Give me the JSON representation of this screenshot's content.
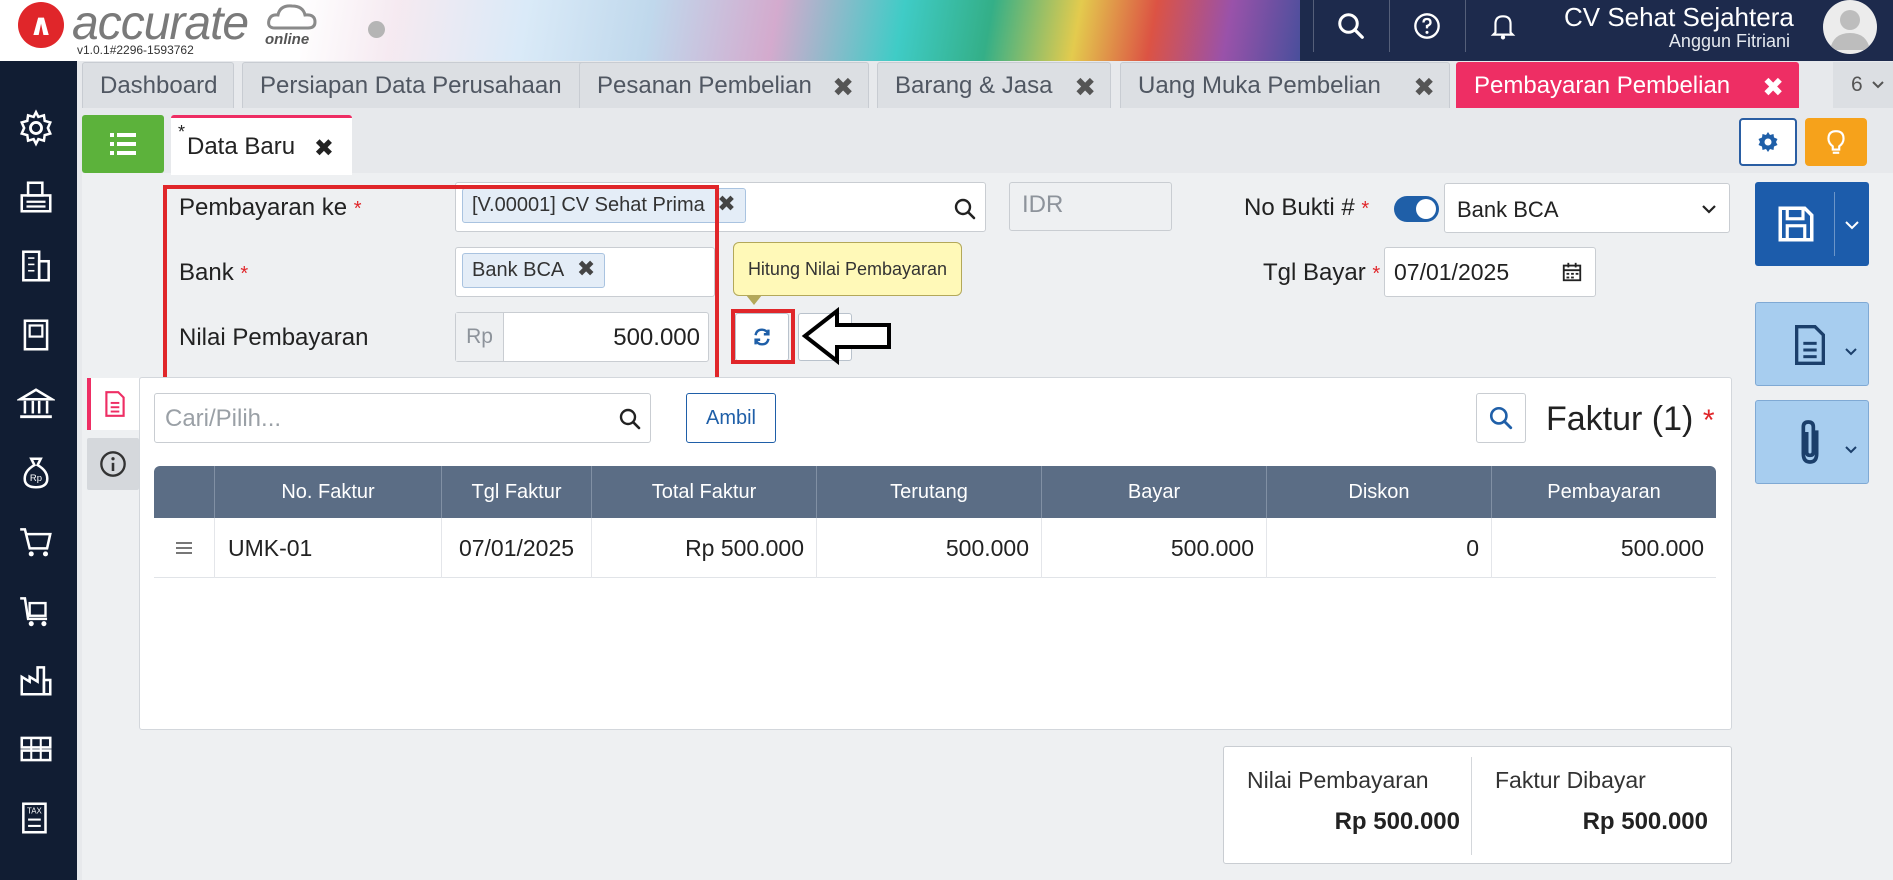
{
  "header": {
    "brand": "accurate",
    "brand_sub": "online",
    "version": "v1.0.1#2296-1593762",
    "company": "CV Sehat Sejahtera",
    "user": "Anggun Fitriani",
    "icons": [
      "search-icon",
      "help-icon",
      "bell-icon",
      "avatar"
    ]
  },
  "sidebar": {
    "items": [
      "gear-icon",
      "fax-icon",
      "building-icon",
      "book-icon",
      "bank-icon",
      "money-bag-icon",
      "cart-icon",
      "cart-box-icon",
      "factory-icon",
      "warehouse-icon",
      "tax-icon"
    ]
  },
  "module_tabs": [
    {
      "label": "Dashboard",
      "closable": false,
      "active": false
    },
    {
      "label": "Persiapan Data Perusahaan",
      "closable": false,
      "active": false
    },
    {
      "label": "Pesanan Pembelian",
      "closable": true,
      "active": false
    },
    {
      "label": "Barang & Jasa",
      "closable": true,
      "active": false
    },
    {
      "label": "Uang Muka Pembelian",
      "closable": true,
      "active": false
    },
    {
      "label": "Pembayaran Pembelian",
      "closable": true,
      "active": true
    }
  ],
  "tab_count": "6",
  "close_symbol": "✖",
  "subtab": {
    "star": "*",
    "label": "Data Baru"
  },
  "form": {
    "pembayaran_ke_label": "Pembayaran ke",
    "pembayaran_ke_value": "[V.00001] CV Sehat Prima",
    "currency": "IDR",
    "bank_label": "Bank",
    "bank_value": "Bank BCA",
    "nilai_label": "Nilai Pembayaran",
    "nilai_prefix": "Rp",
    "nilai_value": "500.000",
    "tooltip": "Hitung Nilai Pembayaran",
    "no_bukti_label": "No Bukti #",
    "no_bukti_value": "Bank BCA",
    "tgl_bayar_label": "Tgl Bayar",
    "tgl_bayar_value": "07/01/2025",
    "required_mark": "*"
  },
  "detail": {
    "search_placeholder": "Cari/Pilih...",
    "ambil_label": "Ambil",
    "title": "Faktur (1)",
    "columns": [
      "No. Faktur",
      "Tgl Faktur",
      "Total Faktur",
      "Terutang",
      "Bayar",
      "Diskon",
      "Pembayaran"
    ],
    "rows": [
      {
        "no_faktur": "UMK-01",
        "tgl_faktur": "07/01/2025",
        "total_faktur": "Rp 500.000",
        "terutang": "500.000",
        "bayar": "500.000",
        "diskon": "0",
        "pembayaran": "500.000"
      }
    ]
  },
  "totals": {
    "nilai_label": "Nilai Pembayaran",
    "nilai_value": "Rp 500.000",
    "faktur_label": "Faktur Dibayar",
    "faktur_value": "Rp 500.000"
  },
  "colors": {
    "accent_pink": "#ee2e64",
    "primary_blue": "#1c5cab",
    "sidebar_bg": "#111d33",
    "highlight_red": "#e0262a",
    "list_green": "#5cb23b",
    "bulb_orange": "#f6a21b"
  }
}
